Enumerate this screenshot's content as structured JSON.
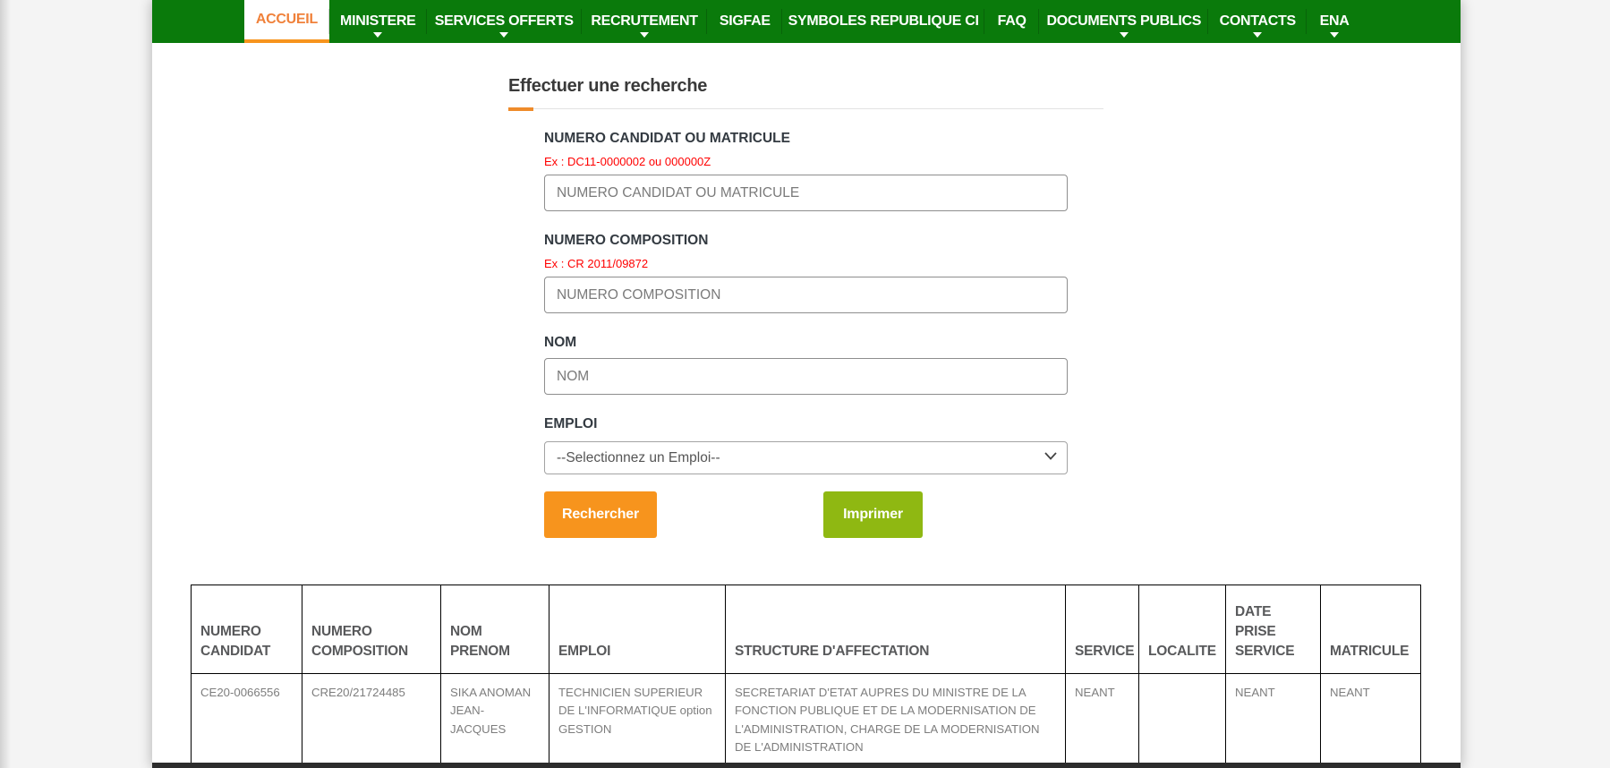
{
  "nav": {
    "items": [
      {
        "label": "ACCUEIL",
        "active": true,
        "has_dropdown": false
      },
      {
        "label": "MINISTERE",
        "active": false,
        "has_dropdown": true
      },
      {
        "label": "SERVICES OFFERTS",
        "active": false,
        "has_dropdown": true
      },
      {
        "label": "RECRUTEMENT",
        "active": false,
        "has_dropdown": true
      },
      {
        "label": "SIGFAE",
        "active": false,
        "has_dropdown": false
      },
      {
        "label": "SYMBOLES REPUBLIQUE CI",
        "active": false,
        "has_dropdown": false
      },
      {
        "label": "FAQ",
        "active": false,
        "has_dropdown": false
      },
      {
        "label": "DOCUMENTS PUBLICS",
        "active": false,
        "has_dropdown": true
      },
      {
        "label": "CONTACTS",
        "active": false,
        "has_dropdown": true
      },
      {
        "label": "ENA",
        "active": false,
        "has_dropdown": true
      }
    ]
  },
  "search": {
    "title": "Effectuer une recherche",
    "fields": [
      {
        "label": "NUMERO CANDIDAT OU MATRICULE",
        "example": "Ex : DC11-0000002 ou 000000Z",
        "placeholder": "NUMERO CANDIDAT OU MATRICULE",
        "value": "",
        "type": "text"
      },
      {
        "label": "NUMERO COMPOSITION",
        "example": "Ex : CR 2011/09872",
        "placeholder": "NUMERO COMPOSITION",
        "value": "",
        "type": "text"
      },
      {
        "label": "NOM",
        "placeholder": "NOM",
        "value": "",
        "type": "text"
      },
      {
        "label": "EMPLOI",
        "selected_option": "--Selectionnez un Emploi--",
        "type": "select"
      }
    ],
    "buttons": {
      "search_label": "Rechercher",
      "print_label": "Imprimer"
    }
  },
  "results_table": {
    "columns": [
      "NUMERO CANDIDAT",
      "NUMERO COMPOSITION",
      "NOM PRENOM",
      "EMPLOI",
      "STRUCTURE D'AFFECTATION",
      "SERVICE",
      "LOCALITE",
      "DATE PRISE SERVICE",
      "MATRICULE"
    ],
    "rows": [
      [
        "CE20-0066556",
        "CRE20/21724485",
        "SIKA ANOMAN JEAN-JACQUES",
        "TECHNICIEN SUPERIEUR DE L'INFORMATIQUE option GESTION",
        "SECRETARIAT D'ETAT AUPRES DU MINISTRE DE LA FONCTION PUBLIQUE ET DE LA MODERNISATION DE L'ADMINISTRATION, CHARGE DE LA MODERNISATION DE L'ADMINISTRATION",
        "NEANT",
        "",
        "NEANT",
        "NEANT"
      ]
    ]
  },
  "colors": {
    "nav_green": "#0a7a0b",
    "active_tab_text": "#f0813a",
    "active_tab_underline": "#f7941d",
    "search_button": "#f7941d",
    "print_button": "#8fb812",
    "example_text_red": "#ff0000",
    "table_border": "#000000",
    "footer_strip": "#2c2c2c"
  }
}
